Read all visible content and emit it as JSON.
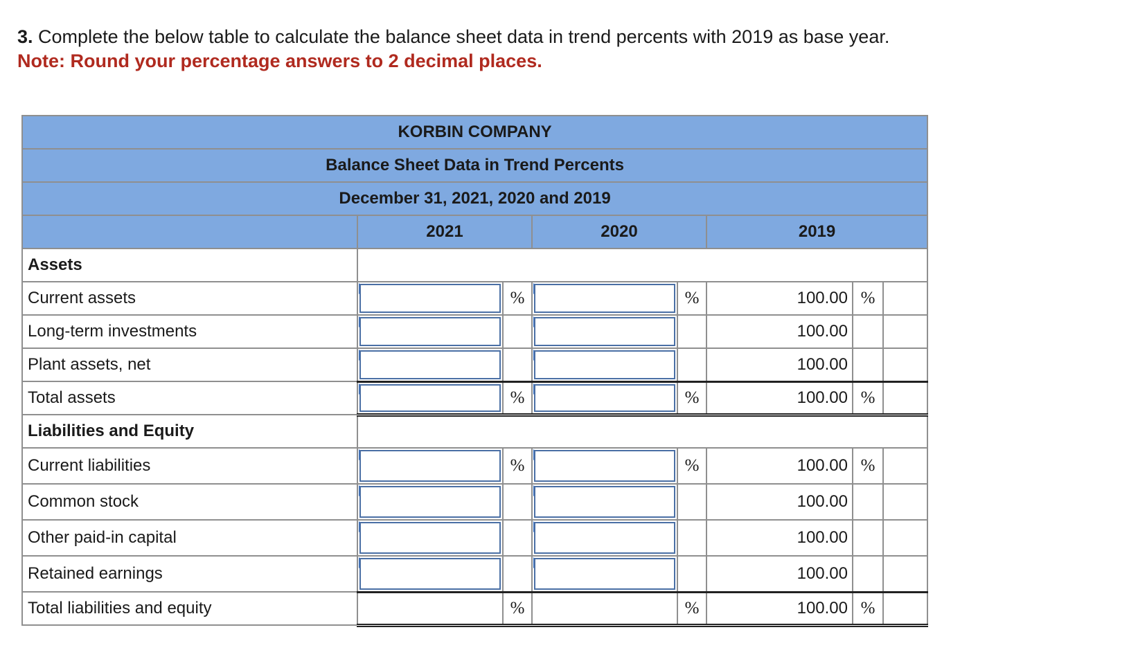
{
  "question": {
    "number": "3.",
    "text": "Complete the below table to calculate the balance sheet data in trend percents with 2019 as base year.",
    "note": "Note: Round your percentage answers to 2 decimal places."
  },
  "table": {
    "company": "KORBIN COMPANY",
    "title": "Balance Sheet Data in Trend Percents",
    "date": "December 31, 2021, 2020 and 2019",
    "years": [
      "2021",
      "2020",
      "2019"
    ],
    "percent_sign": "%",
    "sections": {
      "assets": "Assets",
      "liabilities": "Liabilities and Equity"
    },
    "rows": [
      {
        "label": "Current assets",
        "value_2019": "100.00"
      },
      {
        "label": "Long-term investments",
        "value_2019": "100.00"
      },
      {
        "label": "Plant assets, net",
        "value_2019": "100.00"
      },
      {
        "label": "Total assets",
        "value_2019": "100.00"
      },
      {
        "label": "Current liabilities",
        "value_2019": "100.00"
      },
      {
        "label": "Common stock",
        "value_2019": "100.00"
      },
      {
        "label": "Other paid-in capital",
        "value_2019": "100.00"
      },
      {
        "label": "Retained earnings",
        "value_2019": "100.00"
      },
      {
        "label": "Total liabilities and equity",
        "value_2019": "100.00"
      }
    ]
  },
  "colors": {
    "header_bg": "#7fa9e0",
    "note_red": "#b02a1f",
    "input_border": "#4a6fa5"
  }
}
